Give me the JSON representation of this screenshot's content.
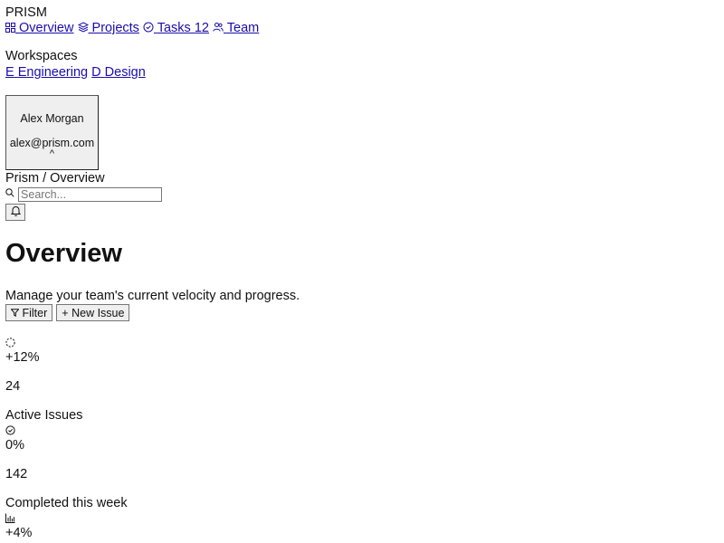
{
  "brand": "PRISM",
  "nav": [
    {
      "label": "Overview",
      "icon": "grid-icon"
    },
    {
      "label": "Projects",
      "icon": "layers-icon"
    },
    {
      "label": "Tasks",
      "badge": "12",
      "icon": "check-circle-icon"
    },
    {
      "label": "Team",
      "icon": "users-icon"
    }
  ],
  "workspaces": {
    "title": "Workspaces",
    "items": [
      {
        "initial": "E",
        "label": "Engineering"
      },
      {
        "initial": "D",
        "label": "Design"
      }
    ]
  },
  "user": {
    "name": "Alex Morgan",
    "email": "alex@prism.com",
    "caret": "^"
  },
  "header": {
    "breadcrumb": "Prism / Overview",
    "search_placeholder": "Search..."
  },
  "page": {
    "title": "Overview",
    "subtitle": "Manage your team's current velocity and progress.",
    "filter_label": "Filter",
    "new_issue_label": "New Issue"
  },
  "stats": [
    {
      "icon": "loader-icon",
      "change": "+12%",
      "value": "24",
      "label": "Active Issues"
    },
    {
      "icon": "check-circle-icon",
      "change": "0%",
      "value": "142",
      "label": "Completed this week"
    },
    {
      "icon": "bar-chart-icon",
      "change": "+4%",
      "value": "",
      "label": ""
    }
  ]
}
